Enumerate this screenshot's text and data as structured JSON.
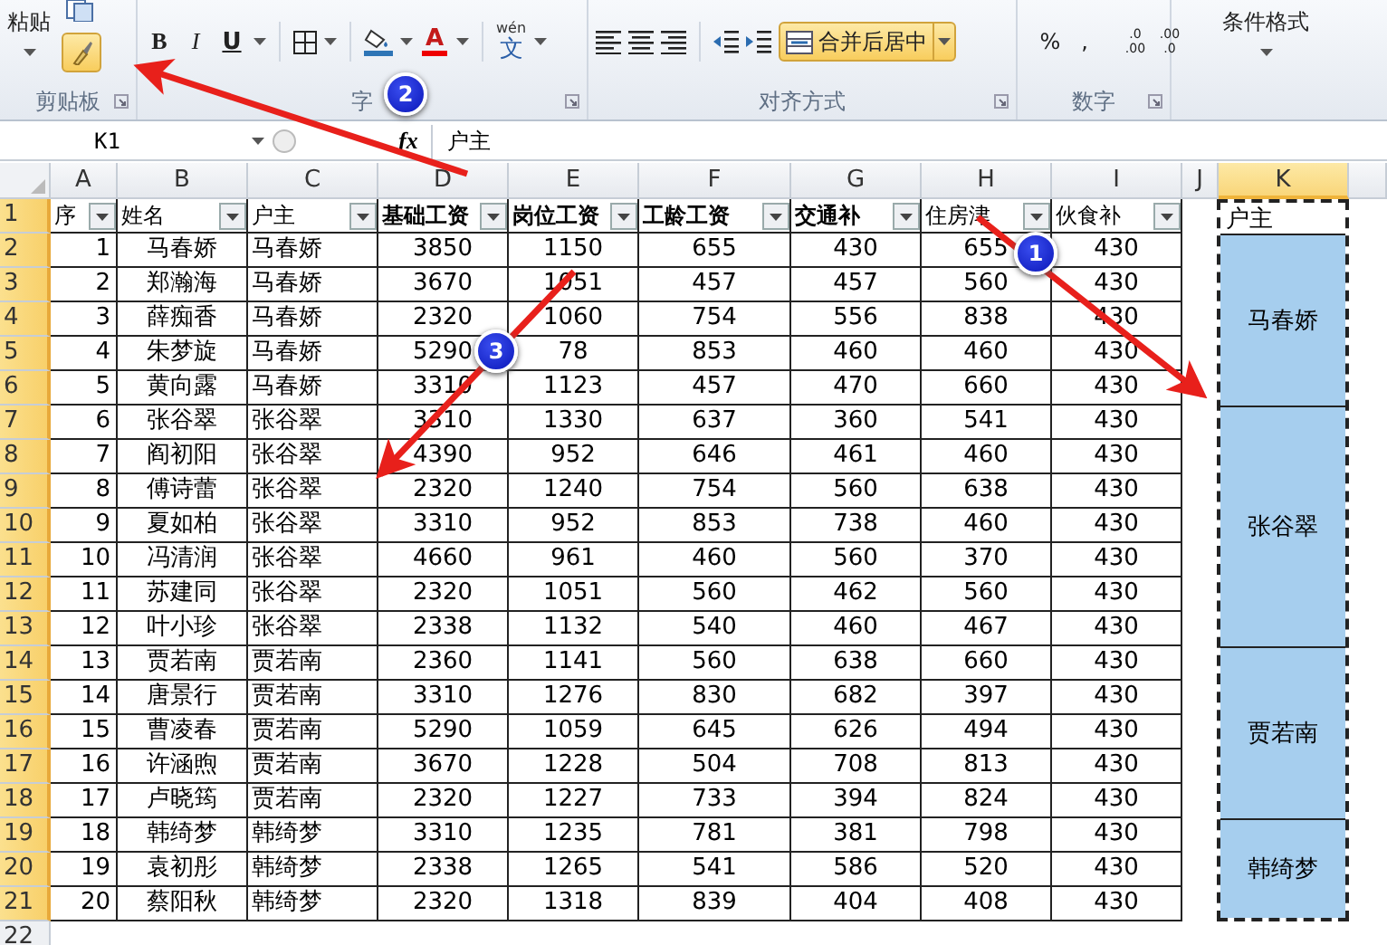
{
  "ribbon": {
    "clipboard": {
      "paste": "粘贴",
      "label": "剪贴板",
      "format_painter_on": true
    },
    "font": {
      "bold": "B",
      "italic": "I",
      "underline": "U",
      "font_color": "A",
      "phonetic_top": "wén",
      "phonetic_char": "文",
      "label": "字"
    },
    "alignment": {
      "merge": {
        "label": "合并后居中",
        "on": true
      },
      "label": "对齐方式"
    },
    "number": {
      "percent": "%",
      "comma": ",",
      "increase_decimal": [
        ".0",
        ".00"
      ],
      "decrease_decimal": [
        ".00",
        ".0"
      ],
      "label": "数字"
    },
    "styles": {
      "conditional_format": "条件格式"
    }
  },
  "formula_bar": {
    "name_box": "K1",
    "fx": "fx",
    "content": "户主"
  },
  "sheet": {
    "columns": [
      {
        "label": "A",
        "selected": false
      },
      {
        "label": "B",
        "selected": false
      },
      {
        "label": "C",
        "selected": false
      },
      {
        "label": "D",
        "selected": false
      },
      {
        "label": "E",
        "selected": false
      },
      {
        "label": "F",
        "selected": false
      },
      {
        "label": "G",
        "selected": false
      },
      {
        "label": "H",
        "selected": false
      },
      {
        "label": "I",
        "selected": false
      },
      {
        "label": "J",
        "selected": false
      },
      {
        "label": "K",
        "selected": true
      }
    ],
    "row_headers": [
      {
        "label": "1",
        "selected": true
      },
      {
        "label": "2",
        "selected": true
      },
      {
        "label": "3",
        "selected": true
      },
      {
        "label": "4",
        "selected": true
      },
      {
        "label": "5",
        "selected": true
      },
      {
        "label": "6",
        "selected": true
      },
      {
        "label": "7",
        "selected": true
      },
      {
        "label": "8",
        "selected": true
      },
      {
        "label": "9",
        "selected": true
      },
      {
        "label": "10",
        "selected": true
      },
      {
        "label": "11",
        "selected": true
      },
      {
        "label": "12",
        "selected": true
      },
      {
        "label": "13",
        "selected": true
      },
      {
        "label": "14",
        "selected": true
      },
      {
        "label": "15",
        "selected": true
      },
      {
        "label": "16",
        "selected": true
      },
      {
        "label": "17",
        "selected": true
      },
      {
        "label": "18",
        "selected": true
      },
      {
        "label": "19",
        "selected": true
      },
      {
        "label": "20",
        "selected": true
      },
      {
        "label": "21",
        "selected": true
      },
      {
        "label": "22",
        "selected": false
      }
    ],
    "header": [
      {
        "text": "序",
        "bold": false
      },
      {
        "text": "姓名",
        "bold": false
      },
      {
        "text": "户主",
        "bold": false
      },
      {
        "text": "基础工资",
        "bold": true
      },
      {
        "text": "岗位工资",
        "bold": true
      },
      {
        "text": "工龄工资",
        "bold": true
      },
      {
        "text": "交通补",
        "bold": true
      },
      {
        "text": "住房津",
        "bold": false
      },
      {
        "text": "伙食补",
        "bold": false
      }
    ],
    "summary_header": "户主",
    "groups": [
      {
        "owner": "马春娇",
        "rows": [
          [
            "1",
            "马春娇",
            "马春娇",
            "3850",
            "1150",
            "655",
            "430",
            "655",
            "430"
          ],
          [
            "2",
            "郑瀚海",
            "马春娇",
            "3670",
            "1051",
            "457",
            "457",
            "560",
            "430"
          ],
          [
            "3",
            "薛痴香",
            "马春娇",
            "2320",
            "1060",
            "754",
            "556",
            "838",
            "430"
          ],
          [
            "4",
            "朱梦旋",
            "马春娇",
            "5290",
            "78",
            "853",
            "460",
            "460",
            "430"
          ],
          [
            "5",
            "黄向露",
            "马春娇",
            "3310",
            "1123",
            "457",
            "470",
            "660",
            "430"
          ]
        ]
      },
      {
        "owner": "张谷翠",
        "rows": [
          [
            "6",
            "张谷翠",
            "张谷翠",
            "3310",
            "1330",
            "637",
            "360",
            "541",
            "430"
          ],
          [
            "7",
            "阎初阳",
            "张谷翠",
            "4390",
            "952",
            "646",
            "461",
            "460",
            "430"
          ],
          [
            "8",
            "傅诗蕾",
            "张谷翠",
            "2320",
            "1240",
            "754",
            "560",
            "638",
            "430"
          ],
          [
            "9",
            "夏如柏",
            "张谷翠",
            "3310",
            "952",
            "853",
            "738",
            "460",
            "430"
          ],
          [
            "10",
            "冯清润",
            "张谷翠",
            "4660",
            "961",
            "460",
            "560",
            "370",
            "430"
          ],
          [
            "11",
            "苏建同",
            "张谷翠",
            "2320",
            "1051",
            "560",
            "462",
            "560",
            "430"
          ],
          [
            "12",
            "叶小珍",
            "张谷翠",
            "2338",
            "1132",
            "540",
            "460",
            "467",
            "430"
          ]
        ]
      },
      {
        "owner": "贾若南",
        "rows": [
          [
            "13",
            "贾若南",
            "贾若南",
            "2360",
            "1141",
            "560",
            "638",
            "660",
            "430"
          ],
          [
            "14",
            "唐景行",
            "贾若南",
            "3310",
            "1276",
            "830",
            "682",
            "397",
            "430"
          ],
          [
            "15",
            "曹凌春",
            "贾若南",
            "5290",
            "1059",
            "645",
            "626",
            "494",
            "430"
          ],
          [
            "16",
            "许涵煦",
            "贾若南",
            "3670",
            "1228",
            "504",
            "708",
            "813",
            "430"
          ],
          [
            "17",
            "卢晓筠",
            "贾若南",
            "2320",
            "1227",
            "733",
            "394",
            "824",
            "430"
          ]
        ]
      },
      {
        "owner": "韩绮梦",
        "rows": [
          [
            "18",
            "韩绮梦",
            "韩绮梦",
            "3310",
            "1235",
            "781",
            "381",
            "798",
            "430"
          ],
          [
            "19",
            "袁初彤",
            "韩绮梦",
            "2338",
            "1265",
            "541",
            "586",
            "520",
            "430"
          ],
          [
            "20",
            "蔡阳秋",
            "韩绮梦",
            "2320",
            "1318",
            "839",
            "404",
            "408",
            "430"
          ]
        ]
      }
    ]
  },
  "callouts": [
    {
      "label": "1"
    },
    {
      "label": "2"
    },
    {
      "label": "3"
    }
  ]
}
